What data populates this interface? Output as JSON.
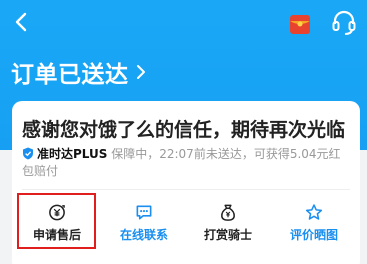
{
  "header": {
    "back_icon": "chevron-left-icon",
    "redpacket_icon": "red-packet-icon",
    "service_icon": "headset-icon",
    "colors": {
      "bg": "#1aa8f6",
      "fg": "#ffffff"
    }
  },
  "order": {
    "status": "订单已送达"
  },
  "card": {
    "thanks": "感谢您对饿了么的信任，期待再次光临",
    "promise": {
      "brand": "准时达PLUS",
      "detail": "保障中，22:07前未送达，可获得5.04元红包赔付"
    }
  },
  "actions": [
    {
      "label": "申请售后",
      "icon": "after-sale-icon",
      "color": "#222222"
    },
    {
      "label": "在线联系",
      "icon": "chat-icon",
      "color": "#1a8ff0"
    },
    {
      "label": "打赏骑士",
      "icon": "money-bag-icon",
      "color": "#222222"
    },
    {
      "label": "评价晒图",
      "icon": "star-icon",
      "color": "#1a8ff0"
    }
  ]
}
